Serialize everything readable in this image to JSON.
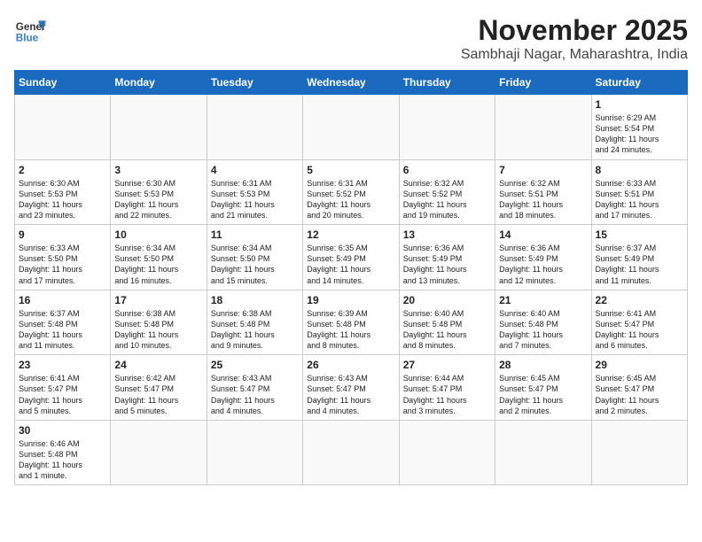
{
  "header": {
    "logo_general": "General",
    "logo_blue": "Blue",
    "month": "November 2025",
    "location": "Sambhaji Nagar, Maharashtra, India"
  },
  "days_of_week": [
    "Sunday",
    "Monday",
    "Tuesday",
    "Wednesday",
    "Thursday",
    "Friday",
    "Saturday"
  ],
  "weeks": [
    [
      {
        "day": "",
        "info": ""
      },
      {
        "day": "",
        "info": ""
      },
      {
        "day": "",
        "info": ""
      },
      {
        "day": "",
        "info": ""
      },
      {
        "day": "",
        "info": ""
      },
      {
        "day": "",
        "info": ""
      },
      {
        "day": "1",
        "info": "Sunrise: 6:29 AM\nSunset: 5:54 PM\nDaylight: 11 hours\nand 24 minutes."
      }
    ],
    [
      {
        "day": "2",
        "info": "Sunrise: 6:30 AM\nSunset: 5:53 PM\nDaylight: 11 hours\nand 23 minutes."
      },
      {
        "day": "3",
        "info": "Sunrise: 6:30 AM\nSunset: 5:53 PM\nDaylight: 11 hours\nand 22 minutes."
      },
      {
        "day": "4",
        "info": "Sunrise: 6:31 AM\nSunset: 5:53 PM\nDaylight: 11 hours\nand 21 minutes."
      },
      {
        "day": "5",
        "info": "Sunrise: 6:31 AM\nSunset: 5:52 PM\nDaylight: 11 hours\nand 20 minutes."
      },
      {
        "day": "6",
        "info": "Sunrise: 6:32 AM\nSunset: 5:52 PM\nDaylight: 11 hours\nand 19 minutes."
      },
      {
        "day": "7",
        "info": "Sunrise: 6:32 AM\nSunset: 5:51 PM\nDaylight: 11 hours\nand 18 minutes."
      },
      {
        "day": "8",
        "info": "Sunrise: 6:33 AM\nSunset: 5:51 PM\nDaylight: 11 hours\nand 17 minutes."
      }
    ],
    [
      {
        "day": "9",
        "info": "Sunrise: 6:33 AM\nSunset: 5:50 PM\nDaylight: 11 hours\nand 17 minutes."
      },
      {
        "day": "10",
        "info": "Sunrise: 6:34 AM\nSunset: 5:50 PM\nDaylight: 11 hours\nand 16 minutes."
      },
      {
        "day": "11",
        "info": "Sunrise: 6:34 AM\nSunset: 5:50 PM\nDaylight: 11 hours\nand 15 minutes."
      },
      {
        "day": "12",
        "info": "Sunrise: 6:35 AM\nSunset: 5:49 PM\nDaylight: 11 hours\nand 14 minutes."
      },
      {
        "day": "13",
        "info": "Sunrise: 6:36 AM\nSunset: 5:49 PM\nDaylight: 11 hours\nand 13 minutes."
      },
      {
        "day": "14",
        "info": "Sunrise: 6:36 AM\nSunset: 5:49 PM\nDaylight: 11 hours\nand 12 minutes."
      },
      {
        "day": "15",
        "info": "Sunrise: 6:37 AM\nSunset: 5:49 PM\nDaylight: 11 hours\nand 11 minutes."
      }
    ],
    [
      {
        "day": "16",
        "info": "Sunrise: 6:37 AM\nSunset: 5:48 PM\nDaylight: 11 hours\nand 11 minutes."
      },
      {
        "day": "17",
        "info": "Sunrise: 6:38 AM\nSunset: 5:48 PM\nDaylight: 11 hours\nand 10 minutes."
      },
      {
        "day": "18",
        "info": "Sunrise: 6:38 AM\nSunset: 5:48 PM\nDaylight: 11 hours\nand 9 minutes."
      },
      {
        "day": "19",
        "info": "Sunrise: 6:39 AM\nSunset: 5:48 PM\nDaylight: 11 hours\nand 8 minutes."
      },
      {
        "day": "20",
        "info": "Sunrise: 6:40 AM\nSunset: 5:48 PM\nDaylight: 11 hours\nand 8 minutes."
      },
      {
        "day": "21",
        "info": "Sunrise: 6:40 AM\nSunset: 5:48 PM\nDaylight: 11 hours\nand 7 minutes."
      },
      {
        "day": "22",
        "info": "Sunrise: 6:41 AM\nSunset: 5:47 PM\nDaylight: 11 hours\nand 6 minutes."
      }
    ],
    [
      {
        "day": "23",
        "info": "Sunrise: 6:41 AM\nSunset: 5:47 PM\nDaylight: 11 hours\nand 5 minutes."
      },
      {
        "day": "24",
        "info": "Sunrise: 6:42 AM\nSunset: 5:47 PM\nDaylight: 11 hours\nand 5 minutes."
      },
      {
        "day": "25",
        "info": "Sunrise: 6:43 AM\nSunset: 5:47 PM\nDaylight: 11 hours\nand 4 minutes."
      },
      {
        "day": "26",
        "info": "Sunrise: 6:43 AM\nSunset: 5:47 PM\nDaylight: 11 hours\nand 4 minutes."
      },
      {
        "day": "27",
        "info": "Sunrise: 6:44 AM\nSunset: 5:47 PM\nDaylight: 11 hours\nand 3 minutes."
      },
      {
        "day": "28",
        "info": "Sunrise: 6:45 AM\nSunset: 5:47 PM\nDaylight: 11 hours\nand 2 minutes."
      },
      {
        "day": "29",
        "info": "Sunrise: 6:45 AM\nSunset: 5:47 PM\nDaylight: 11 hours\nand 2 minutes."
      }
    ],
    [
      {
        "day": "30",
        "info": "Sunrise: 6:46 AM\nSunset: 5:48 PM\nDaylight: 11 hours\nand 1 minute."
      },
      {
        "day": "",
        "info": ""
      },
      {
        "day": "",
        "info": ""
      },
      {
        "day": "",
        "info": ""
      },
      {
        "day": "",
        "info": ""
      },
      {
        "day": "",
        "info": ""
      },
      {
        "day": "",
        "info": ""
      }
    ]
  ]
}
